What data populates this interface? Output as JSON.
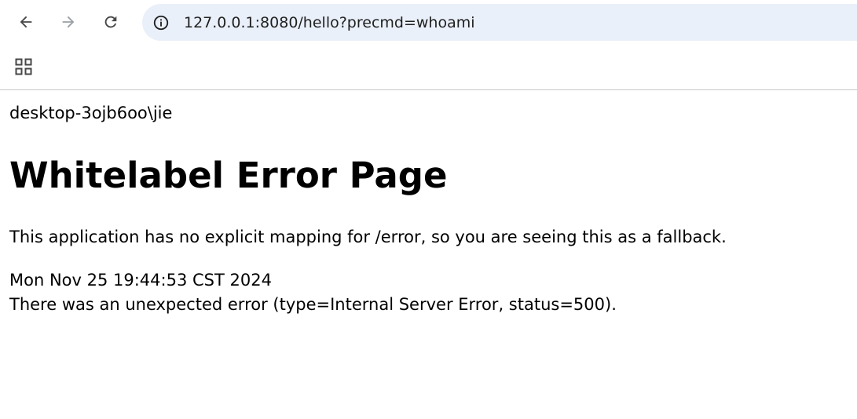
{
  "browser": {
    "url": "127.0.0.1:8080/hello?precmd=whoami",
    "icons": {
      "back": "arrow-left-icon",
      "forward": "arrow-right-icon",
      "reload": "reload-icon",
      "site_info": "info-circle-icon",
      "apps": "apps-grid-icon"
    },
    "colors": {
      "omnibox_bg": "#eaf0fa",
      "forward_disabled": "#9aa0a6"
    }
  },
  "page": {
    "command_output": "desktop-3ojb6oo\\jie",
    "heading": "Whitelabel Error Page",
    "message": "This application has no explicit mapping for /error, so you are seeing this as a fallback.",
    "timestamp": "Mon Nov 25 19:44:53 CST 2024",
    "error_detail": "There was an unexpected error (type=Internal Server Error, status=500)."
  }
}
